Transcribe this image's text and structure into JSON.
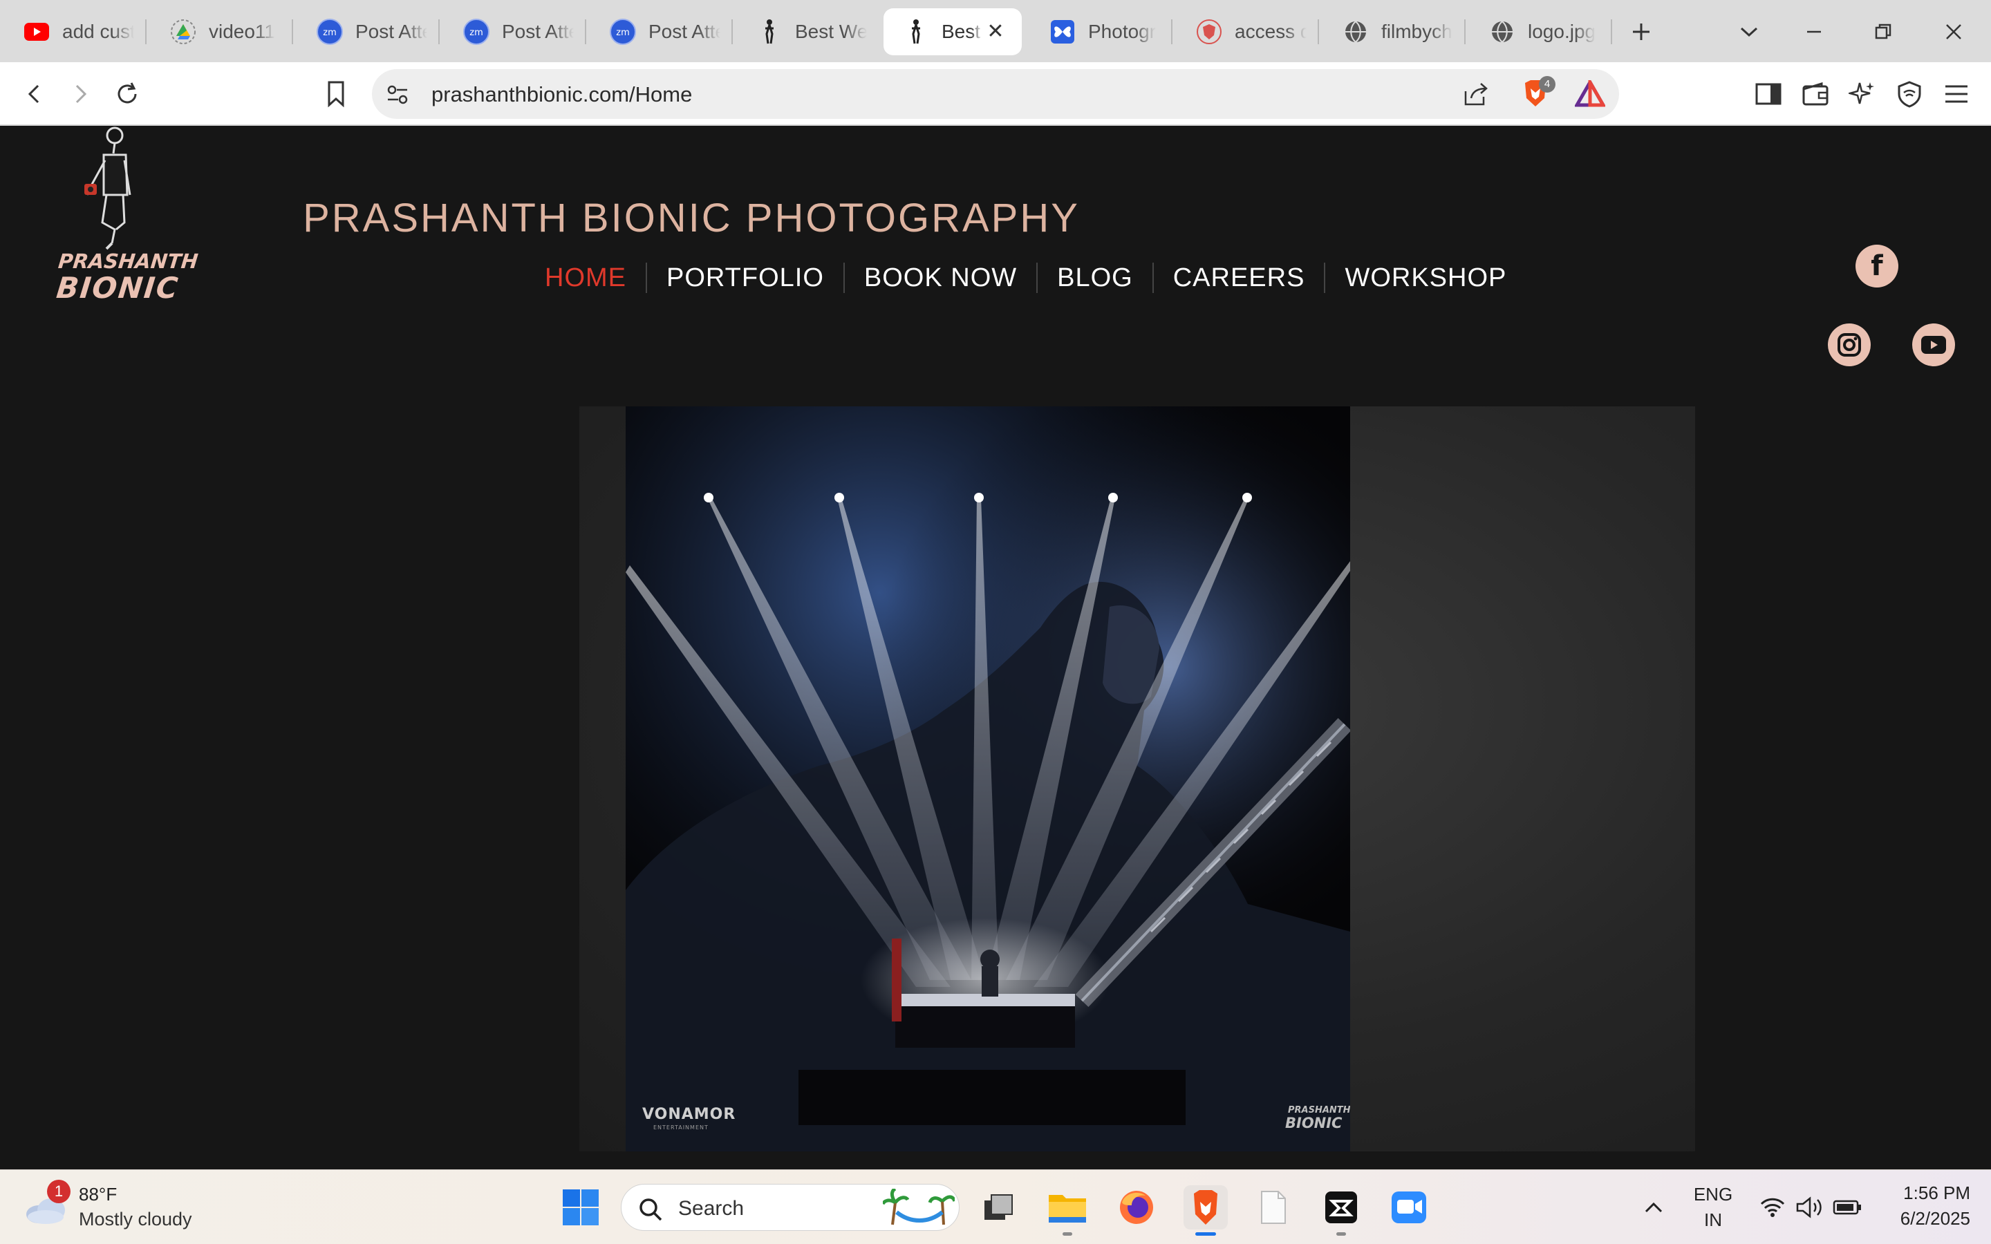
{
  "browser": {
    "tabs": [
      {
        "label": "add cust",
        "icon": "youtube-icon"
      },
      {
        "label": "video11",
        "icon": "google-drive-icon"
      },
      {
        "label": "Post Atte",
        "icon": "zoom-icon"
      },
      {
        "label": "Post Atte",
        "icon": "zoom-icon"
      },
      {
        "label": "Post Atte",
        "icon": "zoom-icon"
      },
      {
        "label": "Best We",
        "icon": "dancer-icon"
      },
      {
        "label": "Best",
        "icon": "dancer-icon",
        "active": true
      },
      {
        "label": "Photogr",
        "icon": "butterfly-icon"
      },
      {
        "label": "access d",
        "icon": "brave-shield-icon"
      },
      {
        "label": "filmbych",
        "icon": "globe-icon"
      },
      {
        "label": "logo.jpg",
        "icon": "globe-icon"
      }
    ],
    "url": "prashanthbionic.com/Home",
    "shield_count": "4"
  },
  "site": {
    "logo_line1": "PRASHANTH",
    "logo_line2": "BIONIC",
    "title": "PRASHANTH BIONIC PHOTOGRAPHY",
    "nav": [
      {
        "label": "HOME",
        "active": true
      },
      {
        "label": "PORTFOLIO"
      },
      {
        "label": "BOOK NOW"
      },
      {
        "label": "BLOG"
      },
      {
        "label": "CAREERS"
      },
      {
        "label": "WORKSHOP"
      }
    ],
    "social": [
      "facebook-icon",
      "instagram-icon",
      "youtube-icon"
    ],
    "hero": {
      "watermark_left": "VONAMOR",
      "watermark_left_sub": "ENTERTAINMENT",
      "watermark_right_line1": "PRASHANTH",
      "watermark_right_line2": "BIONIC"
    }
  },
  "taskbar": {
    "weather_badge": "1",
    "weather_temp": "88°F",
    "weather_desc": "Mostly cloudy",
    "search_placeholder": "Search",
    "lang_line1": "ENG",
    "lang_line2": "IN",
    "time": "1:56 PM",
    "date": "6/2/2025"
  },
  "colors": {
    "accent_nav_active": "#e0392b",
    "site_title": "#ddb3a0",
    "social_bg": "#eac1b2",
    "page_bg": "#161616"
  }
}
